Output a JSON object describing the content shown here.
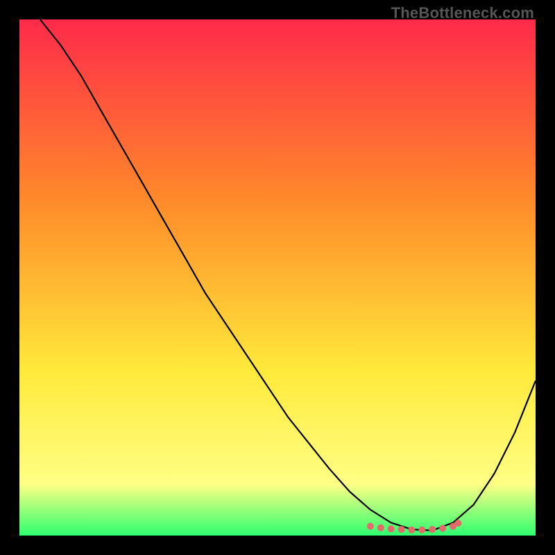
{
  "watermark": "TheBottleneck.com",
  "colors": {
    "gradient_top": "#ff2a4a",
    "gradient_mid1": "#ff8a2a",
    "gradient_mid2": "#ffe93a",
    "gradient_bottom_yellow": "#ffff85",
    "gradient_bottom_green": "#2eff70",
    "curve": "#000000",
    "marker": "#e46a6a",
    "frame": "#000000"
  },
  "chart_data": {
    "type": "line",
    "title": "",
    "xlabel": "",
    "ylabel": "",
    "xlim": [
      0,
      100
    ],
    "ylim": [
      0,
      100
    ],
    "series": [
      {
        "name": "bottleneck-curve",
        "x": [
          4,
          8,
          12,
          16,
          20,
          24,
          28,
          32,
          36,
          40,
          44,
          48,
          52,
          56,
          60,
          64,
          68,
          72,
          76,
          80,
          84,
          88,
          92,
          96,
          100
        ],
        "y": [
          100,
          95,
          89,
          82,
          75,
          68,
          61,
          54,
          47,
          41,
          35,
          29,
          23,
          18,
          13,
          8.5,
          5,
          2.5,
          1.2,
          1,
          2.5,
          6,
          12,
          20,
          30
        ]
      }
    ],
    "optimal_range": {
      "x_start": 68,
      "x_end": 85,
      "y": 1.2
    },
    "markers": {
      "name": "optimal-zone-dots",
      "x": [
        68,
        70,
        72,
        74,
        76,
        78,
        80,
        82,
        84,
        85
      ],
      "y": [
        1.8,
        1.5,
        1.3,
        1.2,
        1.1,
        1.1,
        1.2,
        1.4,
        1.8,
        2.4
      ]
    }
  }
}
